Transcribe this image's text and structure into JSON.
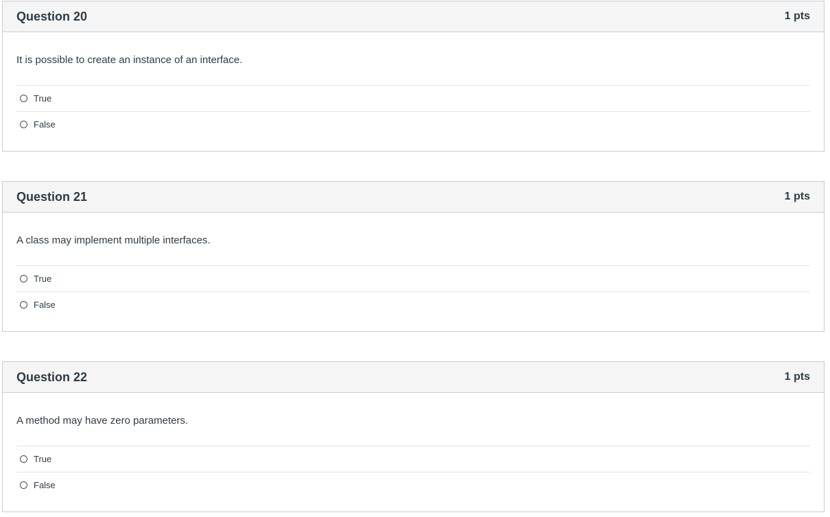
{
  "questions": [
    {
      "title": "Question 20",
      "points": "1 pts",
      "text": "It is possible to create an instance of an interface.",
      "answers": [
        "True",
        "False"
      ]
    },
    {
      "title": "Question 21",
      "points": "1 pts",
      "text": "A class may implement multiple interfaces.",
      "answers": [
        "True",
        "False"
      ]
    },
    {
      "title": "Question 22",
      "points": "1 pts",
      "text": "A method may have zero parameters.",
      "answers": [
        "True",
        "False"
      ]
    }
  ]
}
